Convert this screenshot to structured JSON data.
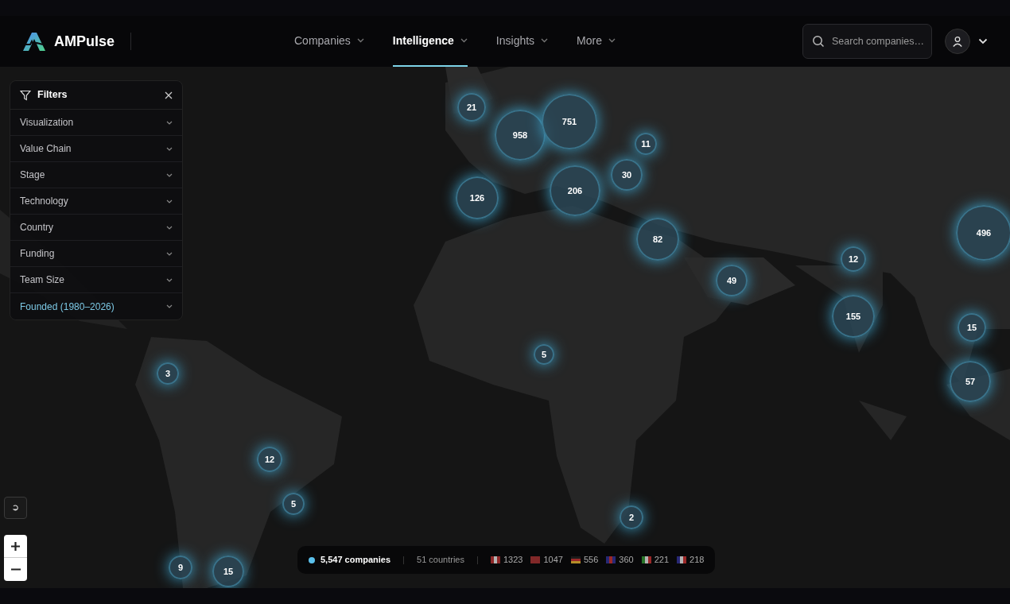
{
  "brand": {
    "name": "AMPulse"
  },
  "nav": [
    {
      "label": "Companies",
      "selected": false
    },
    {
      "label": "Intelligence",
      "selected": true
    },
    {
      "label": "Insights",
      "selected": false
    },
    {
      "label": "More",
      "selected": false
    }
  ],
  "search": {
    "placeholder": "Search companies…"
  },
  "filters": {
    "title": "Filters",
    "items": [
      {
        "label": "Visualization",
        "active": false
      },
      {
        "label": "Value Chain",
        "active": false
      },
      {
        "label": "Stage",
        "active": false
      },
      {
        "label": "Technology",
        "active": false
      },
      {
        "label": "Country",
        "active": false
      },
      {
        "label": "Funding",
        "active": false
      },
      {
        "label": "Team Size",
        "active": false
      },
      {
        "label": "Founded (1980–2026)",
        "active": true
      }
    ]
  },
  "map": {
    "kind": "picture",
    "clusters": [
      "21",
      "958",
      "751",
      "11",
      "30",
      "126",
      "206",
      "82",
      "49",
      "12",
      "496",
      "155",
      "15",
      "57",
      "5",
      "3",
      "12",
      "5",
      "2",
      "9",
      "15"
    ]
  },
  "summary": {
    "companies": "5,547 companies",
    "countries": "51 countries",
    "country_counts": [
      "1323",
      "1047",
      "556",
      "360",
      "221",
      "218"
    ]
  }
}
